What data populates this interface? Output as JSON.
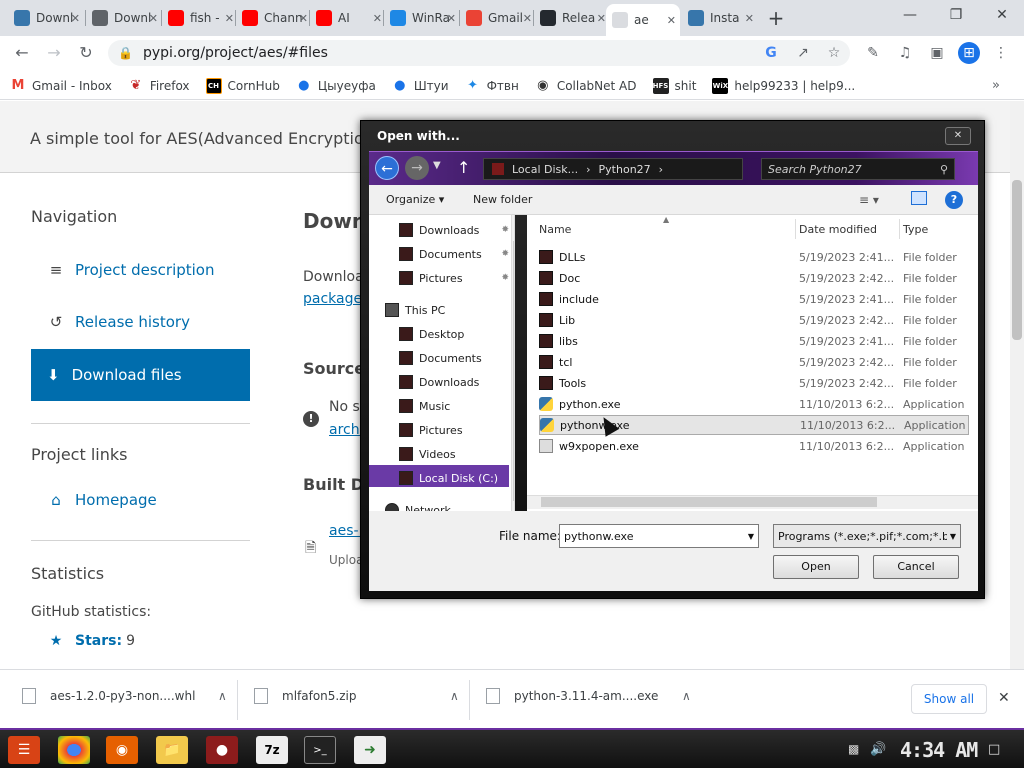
{
  "browser": {
    "tabs": [
      {
        "label": "Downl",
        "icon": "python-icon",
        "color": "#3776ab"
      },
      {
        "label": "Downl",
        "icon": "download-icon",
        "color": "#5f6368"
      },
      {
        "label": "fish -",
        "icon": "youtube-icon",
        "color": "#ff0000"
      },
      {
        "label": "Chann",
        "icon": "youtube-icon",
        "color": "#ff0000"
      },
      {
        "label": "AI",
        "icon": "youtube-icon",
        "color": "#ff0000"
      },
      {
        "label": "WinRa",
        "icon": "winrar-icon",
        "color": "#1e88e5"
      },
      {
        "label": "Gmail",
        "icon": "gmail-icon",
        "color": "#ea4335"
      },
      {
        "label": "Relea",
        "icon": "github-icon",
        "color": "#24292f"
      },
      {
        "label": "ae",
        "icon": "page-icon",
        "color": "#dadce0"
      },
      {
        "label": "Insta",
        "icon": "python-icon",
        "color": "#3776ab"
      }
    ],
    "new_tab": "+",
    "url": "pypi.org/project/aes/#files",
    "bookmarks": [
      {
        "label": "Gmail - Inbox",
        "icon": "gmail-icon"
      },
      {
        "label": "Firefox",
        "icon": "firefox-icon"
      },
      {
        "label": "CornHub",
        "icon": "ch-icon",
        "badge": "CH"
      },
      {
        "label": "Цыуеуфа",
        "icon": "map-pin-icon"
      },
      {
        "label": "Штуи",
        "icon": "map-pin-icon"
      },
      {
        "label": "Фтвн",
        "icon": "star-icon"
      },
      {
        "label": "CollabNet AD",
        "icon": "globe-icon"
      },
      {
        "label": "shit",
        "icon": "hfs-icon",
        "badge": "HFS"
      },
      {
        "label": "help99233 | help9...",
        "icon": "wix-icon",
        "badge": "WiX"
      }
    ]
  },
  "page": {
    "banner": "A simple tool for AES(Advanced Encryption St",
    "nav_heading": "Navigation",
    "nav": [
      {
        "label": "Project description"
      },
      {
        "label": "Release history"
      },
      {
        "label": "Download files"
      }
    ],
    "links_heading": "Project links",
    "homepage": "Homepage",
    "stats_heading": "Statistics",
    "github_stats": "GitHub statistics:",
    "stars_label": "Stars:",
    "stars_value": "9",
    "main": {
      "title": "Down",
      "download_text": "Downloa",
      "packages_link": "package",
      "source_heading": "Source",
      "no_source": "No so",
      "archive_link": "archi",
      "built_heading": "Built Di",
      "built_link": "aes-1",
      "uploaded": "Uploa"
    }
  },
  "downloads": [
    {
      "name": "aes-1.2.0-py3-non....whl"
    },
    {
      "name": "mlfafon5.zip"
    },
    {
      "name": "python-3.11.4-am....exe"
    }
  ],
  "show_all": "Show all",
  "taskbar": {
    "clock": "4:34 AM"
  },
  "dialog": {
    "title": "Open with...",
    "breadcrumb": [
      "Local Disk...",
      "Python27"
    ],
    "search_placeholder": "Search Python27",
    "organize": "Organize",
    "new_folder": "New folder",
    "nav_items": [
      {
        "label": "Downloads",
        "pinned": true
      },
      {
        "label": "Documents",
        "pinned": true
      },
      {
        "label": "Pictures",
        "pinned": true
      },
      {
        "label": "This PC",
        "pinned": false
      },
      {
        "label": "Desktop",
        "pinned": false
      },
      {
        "label": "Documents",
        "pinned": false
      },
      {
        "label": "Downloads",
        "pinned": false
      },
      {
        "label": "Music",
        "pinned": false
      },
      {
        "label": "Pictures",
        "pinned": false
      },
      {
        "label": "Videos",
        "pinned": false
      },
      {
        "label": "Local Disk (C:)",
        "pinned": false
      },
      {
        "label": "Network",
        "pinned": false
      }
    ],
    "columns": {
      "name": "Name",
      "date": "Date modified",
      "type": "Type"
    },
    "files": [
      {
        "name": "DLLs",
        "date": "5/19/2023 2:41...",
        "type": "File folder",
        "kind": "folder"
      },
      {
        "name": "Doc",
        "date": "5/19/2023 2:42...",
        "type": "File folder",
        "kind": "folder"
      },
      {
        "name": "include",
        "date": "5/19/2023 2:41...",
        "type": "File folder",
        "kind": "folder"
      },
      {
        "name": "Lib",
        "date": "5/19/2023 2:42...",
        "type": "File folder",
        "kind": "folder"
      },
      {
        "name": "libs",
        "date": "5/19/2023 2:41...",
        "type": "File folder",
        "kind": "folder"
      },
      {
        "name": "tcl",
        "date": "5/19/2023 2:42...",
        "type": "File folder",
        "kind": "folder"
      },
      {
        "name": "Tools",
        "date": "5/19/2023 2:42...",
        "type": "File folder",
        "kind": "folder"
      },
      {
        "name": "python.exe",
        "date": "11/10/2013 6:2...",
        "type": "Application",
        "kind": "python"
      },
      {
        "name": "pythonw.exe",
        "date": "11/10/2013 6:2...",
        "type": "Application",
        "kind": "python"
      },
      {
        "name": "w9xpopen.exe",
        "date": "11/10/2013 6:2...",
        "type": "Application",
        "kind": "exe"
      }
    ],
    "selected_file": "pythonw.exe",
    "file_name_label": "File name:",
    "file_name_value": "pythonw.exe",
    "file_type_value": "Programs (*.exe;*.pif;*.com;*.ba",
    "open": "Open",
    "cancel": "Cancel"
  }
}
